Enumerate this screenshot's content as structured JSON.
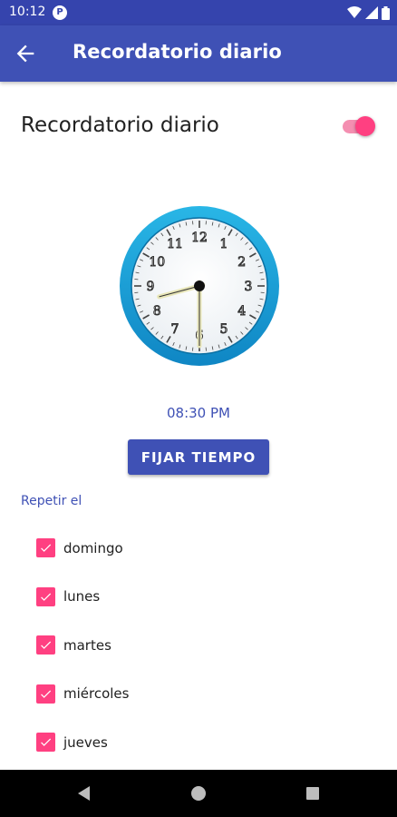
{
  "status_bar": {
    "time": "10:12",
    "notification_icon": "app-notification-icon",
    "icons": [
      "wifi-icon",
      "signal-icon",
      "battery-icon"
    ]
  },
  "app_bar": {
    "back_icon": "arrow-back-icon",
    "title": "Recordatorio diario"
  },
  "reminder": {
    "label": "Recordatorio diario",
    "enabled": true
  },
  "clock": {
    "numbers": [
      "12",
      "1",
      "2",
      "3",
      "4",
      "5",
      "6",
      "7",
      "8",
      "9",
      "10",
      "11"
    ],
    "hour": 8,
    "minute": 30
  },
  "time_text": "08:30 PM",
  "set_button_label": "FIJAR TIEMPO",
  "repeat": {
    "label": "Repetir el",
    "days": [
      {
        "label": "domingo",
        "checked": true
      },
      {
        "label": "lunes",
        "checked": true
      },
      {
        "label": "martes",
        "checked": true
      },
      {
        "label": "miércoles",
        "checked": true
      },
      {
        "label": "jueves",
        "checked": true
      }
    ]
  },
  "nav_bar": {
    "buttons": [
      "back-triangle-icon",
      "home-circle-icon",
      "recents-square-icon"
    ]
  },
  "colors": {
    "primary": "#3f51b5",
    "primary_dark": "#3544ad",
    "accent": "#ff4081"
  }
}
